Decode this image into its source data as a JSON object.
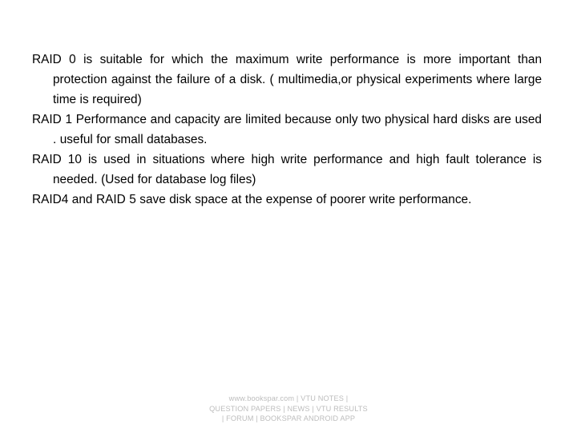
{
  "slide": {
    "background_color": "#ffffff",
    "text_color": "#000000",
    "footer_color": "#bdbdbd"
  },
  "content": {
    "paragraphs": [
      {
        "id": "raid-0",
        "text": "RAID 0 is suitable for which the maximum write performance is more important than protection against the failure of a disk. ( multimedia,or physical experiments where large time is required)"
      },
      {
        "id": "raid-1",
        "text": "RAID 1 Performance and capacity are limited because only two physical hard disks are used . useful for small databases."
      },
      {
        "id": "raid-10",
        "text": "RAID 10 is used in situations where high write performance and high fault tolerance is needed. (Used for database log files)"
      },
      {
        "id": "raid-4-5",
        "text": "RAID4 and RAID 5 save disk space at the expense of poorer write performance."
      }
    ]
  },
  "footer": {
    "lines": [
      "www.bookspar.com | VTU NOTES |",
      "QUESTION PAPERS | NEWS | VTU RESULTS",
      "| FORUM | BOOKSPAR ANDROID APP"
    ]
  }
}
